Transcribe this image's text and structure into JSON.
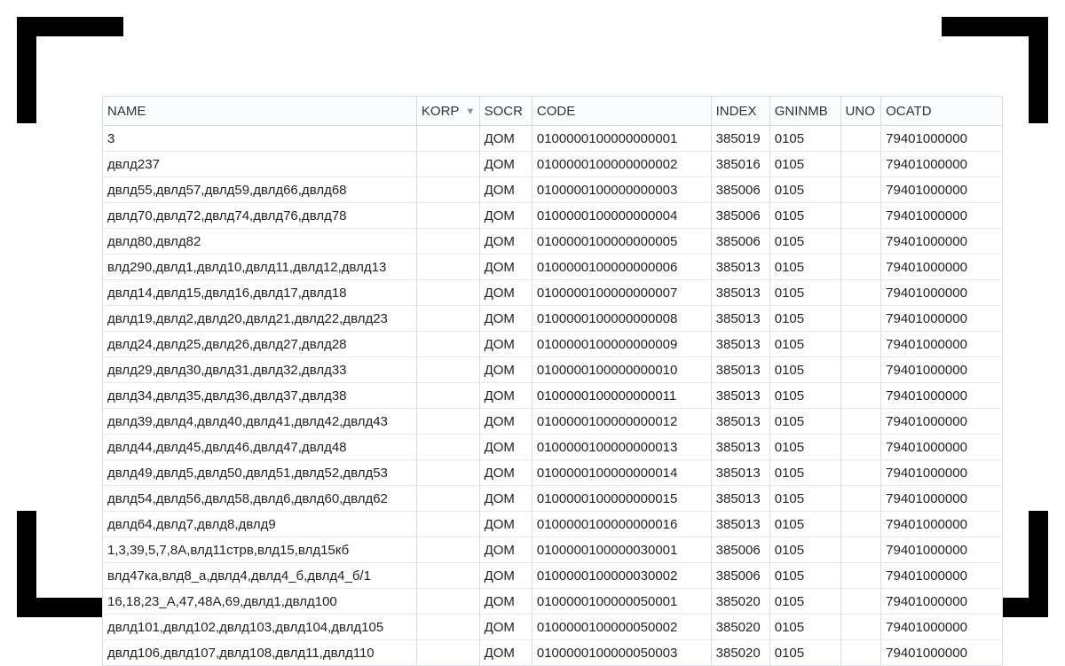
{
  "table": {
    "columns": [
      {
        "key": "name",
        "label": "NAME",
        "sortable": true,
        "sort_indicator": null
      },
      {
        "key": "korp",
        "label": "KORP",
        "sortable": true,
        "sort_indicator": "▼"
      },
      {
        "key": "socr",
        "label": "SOCR",
        "sortable": true,
        "sort_indicator": null
      },
      {
        "key": "code",
        "label": "CODE",
        "sortable": true,
        "sort_indicator": null
      },
      {
        "key": "index",
        "label": "INDEX",
        "sortable": true,
        "sort_indicator": null
      },
      {
        "key": "gninmb",
        "label": "GNINMB",
        "sortable": true,
        "sort_indicator": null
      },
      {
        "key": "uno",
        "label": "UNO",
        "sortable": true,
        "sort_indicator": null
      },
      {
        "key": "ocatd",
        "label": "OCATD",
        "sortable": true,
        "sort_indicator": null
      }
    ],
    "rows": [
      {
        "name": "3",
        "korp": "",
        "socr": "ДОМ",
        "code": "0100000100000000001",
        "index": "385019",
        "gninmb": "0105",
        "uno": "",
        "ocatd": "79401000000"
      },
      {
        "name": "двлд237",
        "korp": "",
        "socr": "ДОМ",
        "code": "0100000100000000002",
        "index": "385016",
        "gninmb": "0105",
        "uno": "",
        "ocatd": "79401000000"
      },
      {
        "name": "двлд55,двлд57,двлд59,двлд66,двлд68",
        "korp": "",
        "socr": "ДОМ",
        "code": "0100000100000000003",
        "index": "385006",
        "gninmb": "0105",
        "uno": "",
        "ocatd": "79401000000"
      },
      {
        "name": "двлд70,двлд72,двлд74,двлд76,двлд78",
        "korp": "",
        "socr": "ДОМ",
        "code": "0100000100000000004",
        "index": "385006",
        "gninmb": "0105",
        "uno": "",
        "ocatd": "79401000000"
      },
      {
        "name": "двлд80,двлд82",
        "korp": "",
        "socr": "ДОМ",
        "code": "0100000100000000005",
        "index": "385006",
        "gninmb": "0105",
        "uno": "",
        "ocatd": "79401000000"
      },
      {
        "name": "влд290,двлд1,двлд10,двлд11,двлд12,двлд13",
        "korp": "",
        "socr": "ДОМ",
        "code": "0100000100000000006",
        "index": "385013",
        "gninmb": "0105",
        "uno": "",
        "ocatd": "79401000000"
      },
      {
        "name": "двлд14,двлд15,двлд16,двлд17,двлд18",
        "korp": "",
        "socr": "ДОМ",
        "code": "0100000100000000007",
        "index": "385013",
        "gninmb": "0105",
        "uno": "",
        "ocatd": "79401000000"
      },
      {
        "name": "двлд19,двлд2,двлд20,двлд21,двлд22,двлд23",
        "korp": "",
        "socr": "ДОМ",
        "code": "0100000100000000008",
        "index": "385013",
        "gninmb": "0105",
        "uno": "",
        "ocatd": "79401000000"
      },
      {
        "name": "двлд24,двлд25,двлд26,двлд27,двлд28",
        "korp": "",
        "socr": "ДОМ",
        "code": "0100000100000000009",
        "index": "385013",
        "gninmb": "0105",
        "uno": "",
        "ocatd": "79401000000"
      },
      {
        "name": "двлд29,двлд30,двлд31,двлд32,двлд33",
        "korp": "",
        "socr": "ДОМ",
        "code": "0100000100000000010",
        "index": "385013",
        "gninmb": "0105",
        "uno": "",
        "ocatd": "79401000000"
      },
      {
        "name": "двлд34,двлд35,двлд36,двлд37,двлд38",
        "korp": "",
        "socr": "ДОМ",
        "code": "0100000100000000011",
        "index": "385013",
        "gninmb": "0105",
        "uno": "",
        "ocatd": "79401000000"
      },
      {
        "name": "двлд39,двлд4,двлд40,двлд41,двлд42,двлд43",
        "korp": "",
        "socr": "ДОМ",
        "code": "0100000100000000012",
        "index": "385013",
        "gninmb": "0105",
        "uno": "",
        "ocatd": "79401000000"
      },
      {
        "name": "двлд44,двлд45,двлд46,двлд47,двлд48",
        "korp": "",
        "socr": "ДОМ",
        "code": "0100000100000000013",
        "index": "385013",
        "gninmb": "0105",
        "uno": "",
        "ocatd": "79401000000"
      },
      {
        "name": "двлд49,двлд5,двлд50,двлд51,двлд52,двлд53",
        "korp": "",
        "socr": "ДОМ",
        "code": "0100000100000000014",
        "index": "385013",
        "gninmb": "0105",
        "uno": "",
        "ocatd": "79401000000"
      },
      {
        "name": "двлд54,двлд56,двлд58,двлд6,двлд60,двлд62",
        "korp": "",
        "socr": "ДОМ",
        "code": "0100000100000000015",
        "index": "385013",
        "gninmb": "0105",
        "uno": "",
        "ocatd": "79401000000"
      },
      {
        "name": "двлд64,двлд7,двлд8,двлд9",
        "korp": "",
        "socr": "ДОМ",
        "code": "0100000100000000016",
        "index": "385013",
        "gninmb": "0105",
        "uno": "",
        "ocatd": "79401000000"
      },
      {
        "name": "1,3,39,5,7,8А,влд11стрв,влд15,влд15кб",
        "korp": "",
        "socr": "ДОМ",
        "code": "0100000100000030001",
        "index": "385006",
        "gninmb": "0105",
        "uno": "",
        "ocatd": "79401000000"
      },
      {
        "name": "влд47ка,влд8_а,двлд4,двлд4_б,двлд4_б/1",
        "korp": "",
        "socr": "ДОМ",
        "code": "0100000100000030002",
        "index": "385006",
        "gninmb": "0105",
        "uno": "",
        "ocatd": "79401000000"
      },
      {
        "name": "16,18,23_А,47,48А,69,двлд1,двлд100",
        "korp": "",
        "socr": "ДОМ",
        "code": "0100000100000050001",
        "index": "385020",
        "gninmb": "0105",
        "uno": "",
        "ocatd": "79401000000"
      },
      {
        "name": "двлд101,двлд102,двлд103,двлд104,двлд105",
        "korp": "",
        "socr": "ДОМ",
        "code": "0100000100000050002",
        "index": "385020",
        "gninmb": "0105",
        "uno": "",
        "ocatd": "79401000000"
      },
      {
        "name": "двлд106,двлд107,двлд108,двлд11,двлд110",
        "korp": "",
        "socr": "ДОМ",
        "code": "0100000100000050003",
        "index": "385020",
        "gninmb": "0105",
        "uno": "",
        "ocatd": "79401000000"
      }
    ]
  }
}
